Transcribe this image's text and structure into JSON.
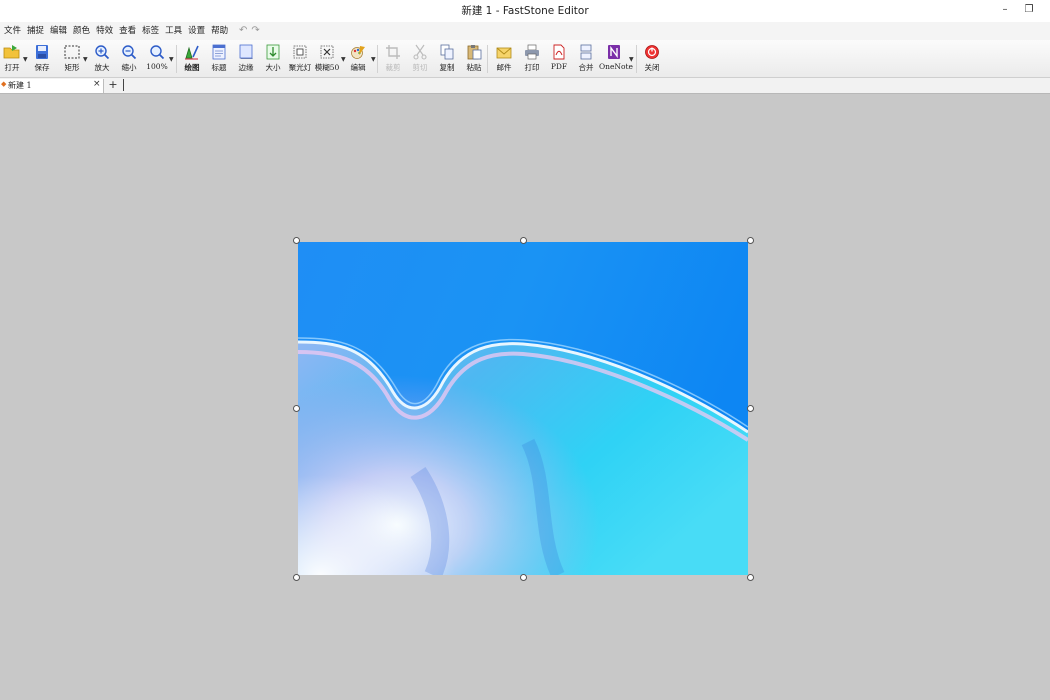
{
  "window": {
    "title": "新建 1 - FastStone Editor",
    "minimize": "–",
    "restore": "❐"
  },
  "menu": [
    "文件",
    "捕捉",
    "编辑",
    "颜色",
    "特效",
    "查看",
    "标签",
    "工具",
    "设置",
    "帮助"
  ],
  "toolbar": {
    "open": "打开",
    "save": "保存",
    "rect": "矩形",
    "zoom_in": "放大",
    "zoom_out": "缩小",
    "zoom_100": "100%",
    "draw": "绘图",
    "caption": "标题",
    "edge": "边缘",
    "resize": "大小",
    "spotlight": "聚光灯",
    "blur": "模糊50",
    "edit": "编辑",
    "crop": "裁剪",
    "cut": "剪切",
    "copy": "复制",
    "paste": "粘贴",
    "mail": "邮件",
    "print": "打印",
    "pdf": "PDF",
    "combine": "合并",
    "onenote": "OneNote",
    "close": "关闭"
  },
  "tabs": {
    "active_label": "新建 1",
    "close_glyph": "×",
    "new_tab": "+"
  },
  "colors": {
    "workspace": "#c8c8c8",
    "image_sky": "#1f8cf2"
  }
}
